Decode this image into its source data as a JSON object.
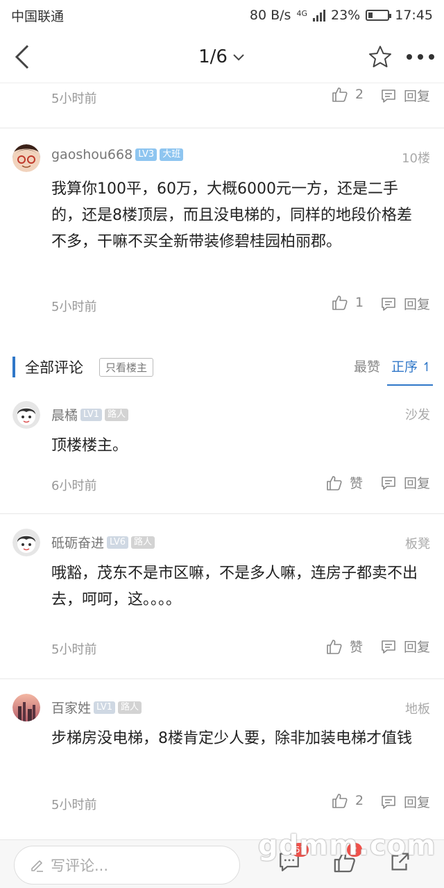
{
  "status_bar": {
    "carrier": "中国联通",
    "speed": "80 B/s",
    "network": "4G",
    "battery": "23%",
    "battery_level": 0.23,
    "time": "17:45"
  },
  "nav": {
    "page_indicator": "1/6",
    "icons": {
      "back": "chevron-left-icon",
      "dropdown": "chevron-down-icon",
      "favorite": "star-icon",
      "more": "more-dots-icon"
    }
  },
  "top_post_meta": {
    "time": "5小时前",
    "likes": "2",
    "reply_label": "回复"
  },
  "posts": [
    {
      "username": "gaoshou668",
      "level": "LV3",
      "title": "大班",
      "floor": "10楼",
      "content": "我算你100平，60万，大概6000元一方，还是二手的，还是8楼顶层，而且没电梯的，同样的地段价格差不多，干嘛不买全新带装修碧桂园柏丽郡。",
      "time": "5小时前",
      "likes": "1",
      "reply_label": "回复"
    }
  ],
  "section": {
    "title": "全部评论",
    "only_host": "只看楼主",
    "sort_hot": "最赞",
    "sort_order": "正序"
  },
  "comments": [
    {
      "username": "晨橘",
      "level": "LV1",
      "title": "路人",
      "floor": "沙发",
      "content": "顶楼楼主。",
      "time": "6小时前",
      "likes": "赞",
      "reply_label": "回复"
    },
    {
      "username": "砥砺奋进",
      "level": "LV6",
      "title": "路人",
      "floor": "板凳",
      "content": "哦豁，茂东不是市区嘛，不是多人嘛，连房子都卖不出去，呵呵，这。。。。",
      "time": "5小时前",
      "likes": "赞",
      "reply_label": "回复"
    },
    {
      "username": "百家姓",
      "level": "LV1",
      "title": "路人",
      "floor": "地板",
      "content": "步梯房没电梯，8楼肯定少人要，除非加装电梯才值钱",
      "time": "5小时前",
      "likes": "2",
      "reply_label": "回复"
    }
  ],
  "bottom_bar": {
    "comment_placeholder": "写评论...",
    "comment_count": "57",
    "like_count": "2",
    "watermark": "gdmm.com"
  }
}
